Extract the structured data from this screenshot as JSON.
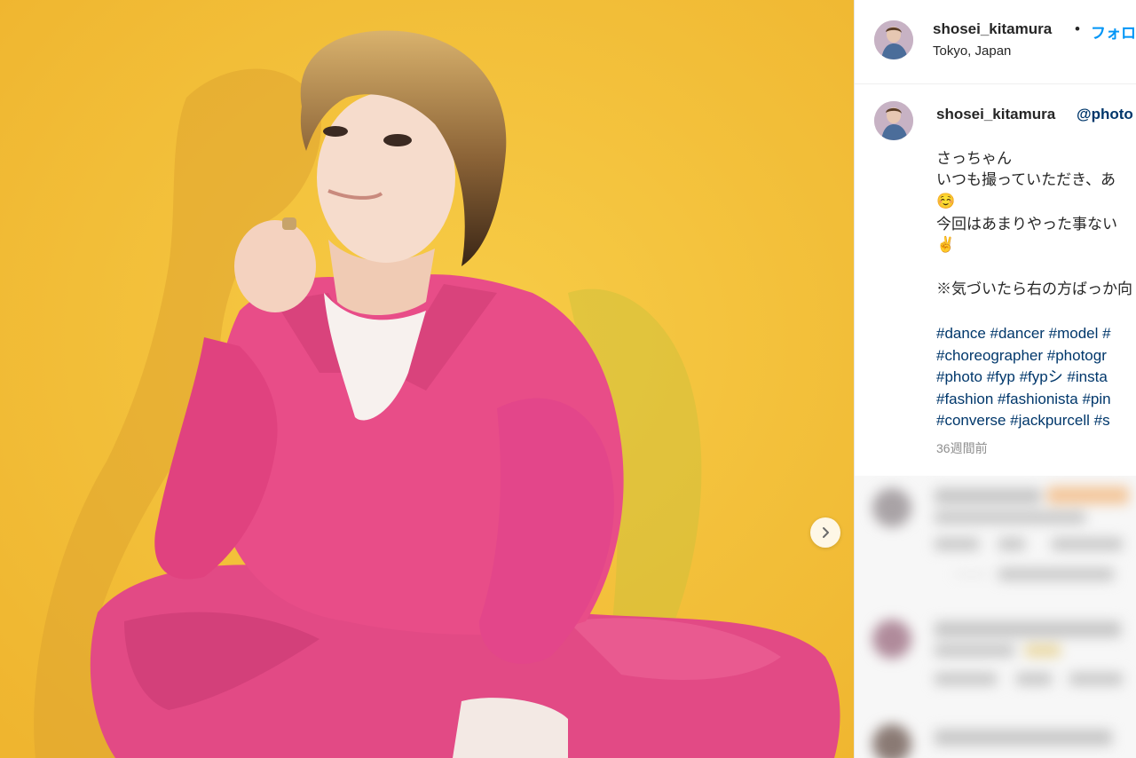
{
  "post": {
    "username": "shosei_kitamura",
    "follow_label": "フォロー",
    "location": "Tokyo, Japan"
  },
  "caption": {
    "username": "shosei_kitamura",
    "mention": "@photo",
    "lines": [
      "さっちゃん",
      "いつも撮っていただき、あ",
      "今回はあまりやった事ない",
      "※気づいたら右の方ばっか向"
    ],
    "emojis": [
      "☺️",
      "✌️"
    ],
    "hashtag_lines": [
      "#dance #dancer #model #",
      "#choreographer #photogr",
      "#photo #fyp #fypシ #insta",
      "#fashion #fashionista #pin",
      "#converse #jackpurcell #s"
    ],
    "time_ago": "36週間前"
  },
  "icons": [
    "chevron-right-icon"
  ],
  "colors": {
    "background_yellow": "#f2c03c",
    "jumpsuit_pink": "#e84d88",
    "link_blue": "#0095f6",
    "hashtag_blue": "#00376b"
  }
}
